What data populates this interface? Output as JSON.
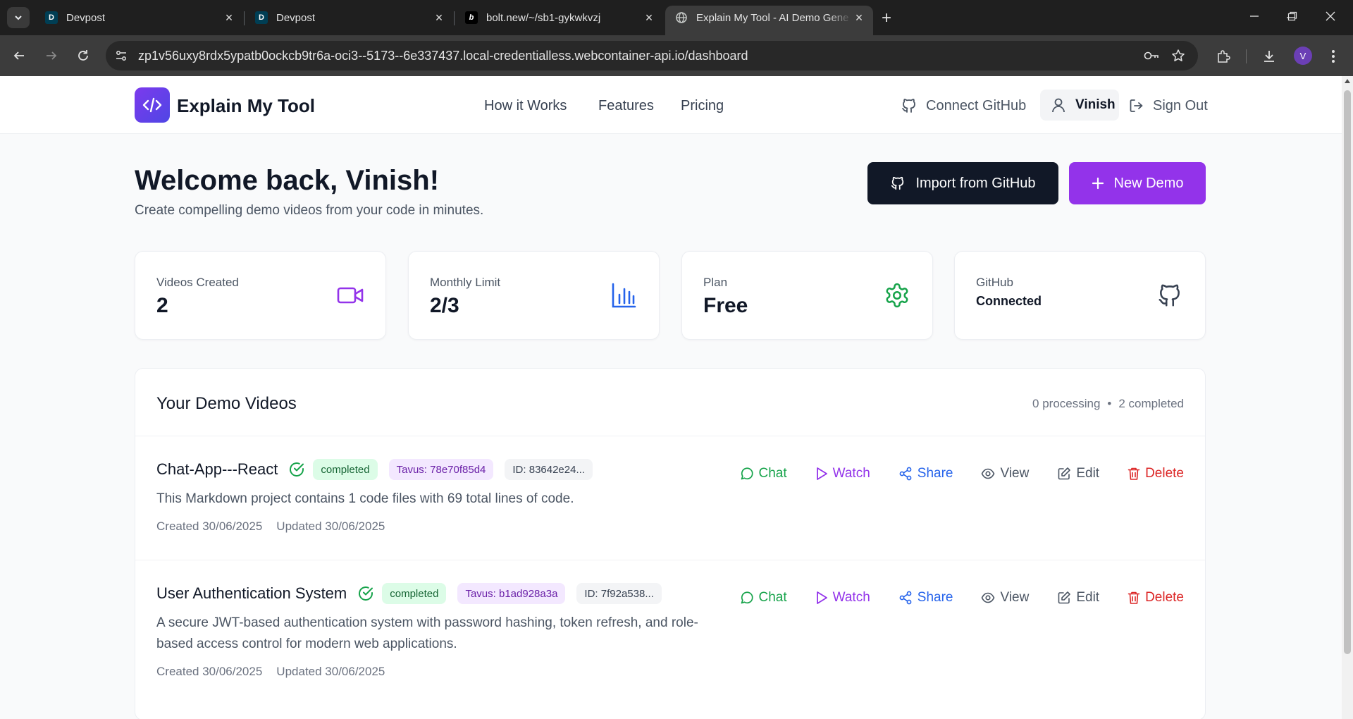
{
  "browser": {
    "tabs": [
      {
        "title": "Devpost",
        "favicon": "D"
      },
      {
        "title": "Devpost",
        "favicon": "D"
      },
      {
        "title": "bolt.new/~/sb1-gykwkvzj",
        "favicon": "b"
      },
      {
        "title": "Explain My Tool - AI Demo Gene",
        "favicon": "globe"
      }
    ],
    "url": "zp1v56uxy8rdx5ypatb0ockcb9tr6a-oci3--5173--6e337437.local-credentialless.webcontainer-api.io/dashboard",
    "profile_initial": "V"
  },
  "header": {
    "brand": "Explain My Tool",
    "nav": [
      "How it Works",
      "Features",
      "Pricing"
    ],
    "connect_github": "Connect GitHub",
    "user_name": "Vinish",
    "sign_out": "Sign Out"
  },
  "welcome": {
    "title": "Welcome back, Vinish!",
    "subtitle": "Create compelling demo videos from your code in minutes.",
    "import_button": "Import from GitHub",
    "new_demo_button": "New Demo"
  },
  "stats": [
    {
      "label": "Videos Created",
      "value": "2",
      "icon": "video-icon",
      "color": "#9333ea"
    },
    {
      "label": "Monthly Limit",
      "value": "2/3",
      "icon": "bar-chart-icon",
      "color": "#2563eb"
    },
    {
      "label": "Plan",
      "value": "Free",
      "icon": "gear-icon",
      "color": "#16a34a"
    },
    {
      "label": "GitHub",
      "value": "Connected",
      "icon": "github-icon",
      "color": "#374151"
    }
  ],
  "demos": {
    "title": "Your Demo Videos",
    "processing": "0 processing",
    "separator": "•",
    "completed": "2 completed",
    "actions": {
      "chat": "Chat",
      "watch": "Watch",
      "share": "Share",
      "view": "View",
      "edit": "Edit",
      "delete": "Delete"
    },
    "items": [
      {
        "name": "Chat-App---React",
        "status": "completed",
        "tavus": "Tavus: 78e70f85d4",
        "id": "ID: 83642e24...",
        "description": "This Markdown project contains 1 code files with 69 total lines of code.",
        "created": "Created 30/06/2025",
        "updated": "Updated 30/06/2025"
      },
      {
        "name": "User Authentication System",
        "status": "completed",
        "tavus": "Tavus: b1ad928a3a",
        "id": "ID: 7f92a538...",
        "description": "A secure JWT-based authentication system with password hashing, token refresh, and role-based access control for modern web applications.",
        "created": "Created 30/06/2025",
        "updated": "Updated 30/06/2025"
      }
    ]
  },
  "colors": {
    "accent": "#9333ea",
    "dark_button": "#111827",
    "success": "#16a34a",
    "link": "#2563eb",
    "danger": "#dc2626"
  }
}
